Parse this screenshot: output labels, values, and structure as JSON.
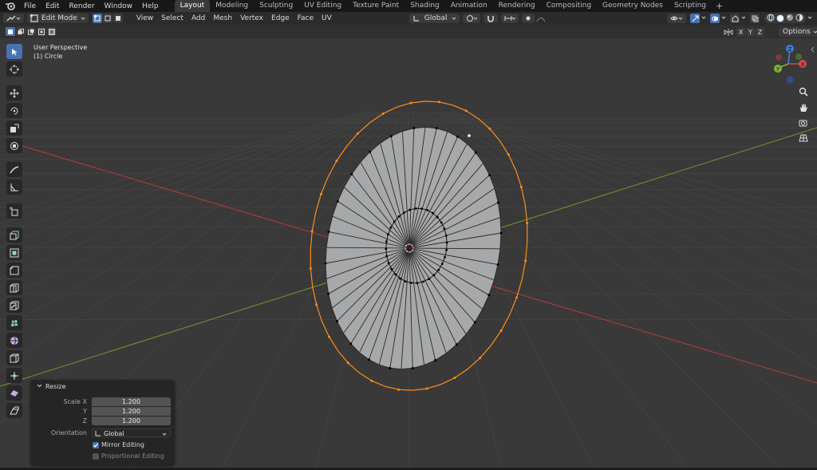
{
  "topbar": {
    "menus": [
      "File",
      "Edit",
      "Render",
      "Window",
      "Help"
    ],
    "workspaces": [
      "Layout",
      "Modeling",
      "Sculpting",
      "UV Editing",
      "Texture Paint",
      "Shading",
      "Animation",
      "Rendering",
      "Compositing",
      "Geometry Nodes",
      "Scripting"
    ],
    "active_workspace": "Layout",
    "add_tab": "+"
  },
  "header": {
    "mode": "Edit Mode",
    "menus": [
      "View",
      "Select",
      "Add",
      "Mesh",
      "Vertex",
      "Edge",
      "Face",
      "UV"
    ],
    "orientation": "Global",
    "axes": [
      "X",
      "Y",
      "Z"
    ],
    "options": "Options"
  },
  "viewport": {
    "view_name": "User Perspective",
    "object_name": "(1) Circle"
  },
  "gizmo": {
    "x": "X",
    "y": "Y",
    "z": "Z"
  },
  "resize_panel": {
    "title": "Resize",
    "scale_x_label": "Scale X",
    "y_label": "Y",
    "z_label": "Z",
    "scale_x": "1.200",
    "scale_y": "1.200",
    "scale_z": "1.200",
    "orientation_label": "Orientation",
    "orientation_value": "Global",
    "mirror_label": "Mirror Editing",
    "mirror_checked": true,
    "proportional_label": "Proportional Editing",
    "proportional_checked": false
  },
  "colors": {
    "accent": "#4772b3",
    "selection": "#ff8c1a",
    "x_axis": "#b83a3a",
    "y_axis": "#6f9a2d",
    "mesh_face": "#a7a8a9"
  }
}
